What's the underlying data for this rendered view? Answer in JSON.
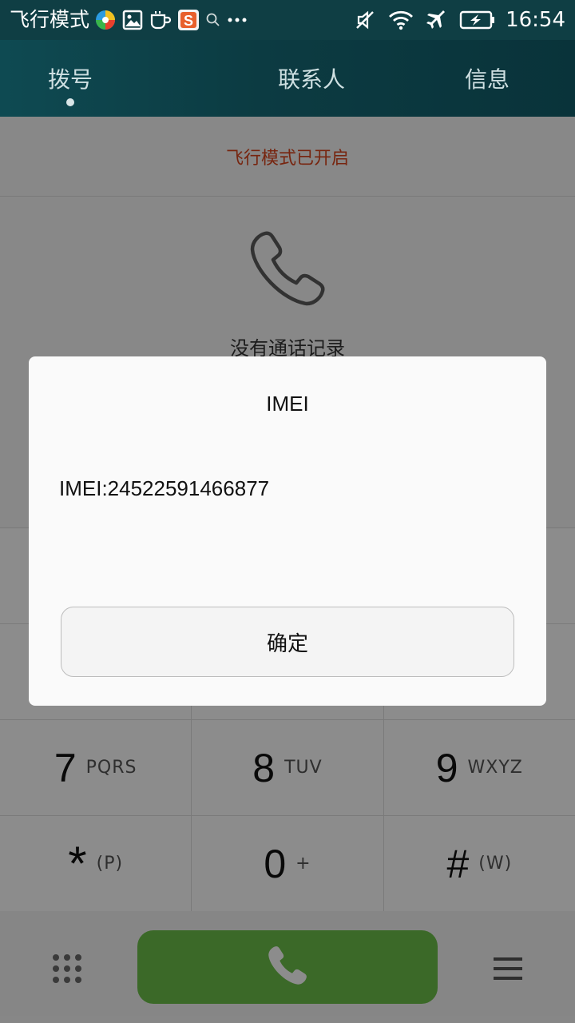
{
  "status_bar": {
    "mode_label": "飞行模式",
    "time": "16:54",
    "icons": [
      "app-colorful-icon",
      "image-icon",
      "cup-icon",
      "sogou-s-icon",
      "search-icon",
      "more-dots-icon",
      "mute-icon",
      "wifi-icon",
      "airplane-icon",
      "battery-charging-icon"
    ]
  },
  "tabs": [
    {
      "label": "拨号"
    },
    {
      "label": "联系人"
    },
    {
      "label": "信息"
    }
  ],
  "airplane_banner": "飞行模式已开启",
  "empty_log": {
    "text": "没有通话记录",
    "icon": "phone-icon"
  },
  "dialpad": {
    "rows": [
      [
        {
          "digit": "7",
          "letters": "PQRS"
        },
        {
          "digit": "8",
          "letters": "TUV"
        },
        {
          "digit": "9",
          "letters": "WXYZ"
        }
      ],
      [
        {
          "digit": "*",
          "letters": "(P)"
        },
        {
          "digit": "0",
          "letters": "+"
        },
        {
          "digit": "#",
          "letters": "(W)"
        }
      ]
    ]
  },
  "bottom_bar": {
    "icons": [
      "dialpad-grid-icon",
      "call-icon",
      "menu-icon"
    ]
  },
  "dialog": {
    "title": "IMEI",
    "message": "IMEI:24522591466877",
    "confirm_label": "确定"
  },
  "colors": {
    "header_bg": "#0f3e44",
    "banner_text": "#d9441c",
    "call_button": "#6cc04a"
  }
}
